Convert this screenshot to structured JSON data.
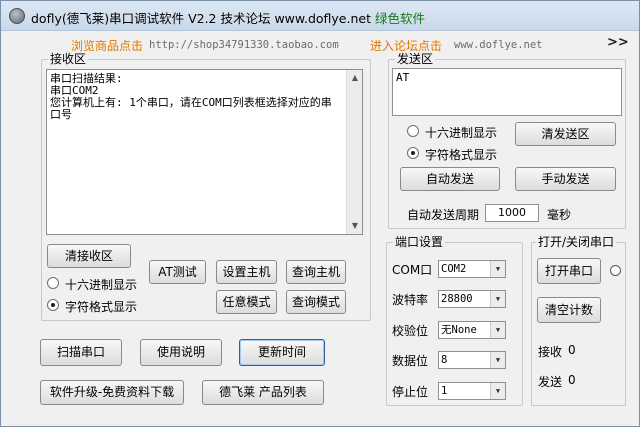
{
  "window": {
    "title_main": "dofly(德飞莱)串口调试软件 V2.2 技术论坛 www.doflye.net",
    "title_green": "绿色软件"
  },
  "info_bar": {
    "shop_link": "浏览商品点击",
    "shop_url": "http://shop34791330.taobao.com",
    "forum_link": "进入论坛点击",
    "forum_url": "www.doflye.net",
    "expand_label": ">>"
  },
  "receive": {
    "group_label": "接收区",
    "content": "串口扫描结果:\n串口COM2\n您计算机上有: 1个串口，请在COM口列表框选择对应的串口号",
    "clear_label": "清接收区",
    "hex_label": "十六进制显示",
    "char_label": "字符格式显示"
  },
  "send": {
    "group_label": "发送区",
    "content": "AT",
    "hex_label": "十六进制显示",
    "char_label": "字符格式显示",
    "clear_label": "清发送区",
    "auto_label": "自动发送",
    "manual_label": "手动发送",
    "period_label": "自动发送周期",
    "period_value": "1000",
    "period_unit": "毫秒"
  },
  "commands": {
    "at_test": "AT测试",
    "set_master": "设置主机",
    "query_master": "查询主机",
    "slave_mode": "任意模式",
    "query_mode": "查询模式"
  },
  "bottom": {
    "scan": "扫描串口",
    "help": "使用说明",
    "update_time": "更新时间",
    "upgrade": "软件升级-免费资料下载",
    "products": "德飞莱 产品列表"
  },
  "port_settings": {
    "group_label": "端口设置",
    "com_label": "COM口",
    "com_value": "COM2",
    "baud_label": "波特率",
    "baud_value": "28800",
    "parity_label": "校验位",
    "parity_value": "无None",
    "data_label": "数据位",
    "data_value": "8",
    "stop_label": "停止位",
    "stop_value": "1"
  },
  "port_control": {
    "group_label": "打开/关闭串口",
    "open_label": "打开串口",
    "clear_count_label": "清空计数",
    "recv_label": "接收",
    "recv_count": "0",
    "send_label": "发送",
    "send_count": "0"
  },
  "colors": {
    "accent_orange": "#e07800",
    "title_green": "#147a14"
  },
  "icons": {
    "app": "app-icon",
    "status_led": "status-led-icon"
  }
}
